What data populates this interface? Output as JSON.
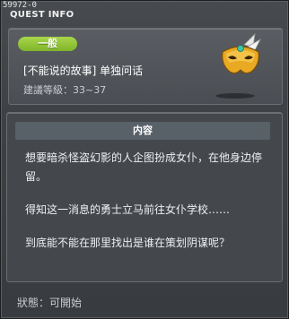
{
  "window": {
    "quest_id": "59972-0",
    "title": "QUEST INFO"
  },
  "quest": {
    "category_badge": "一般",
    "name": "[不能说的故事] 单独问话",
    "level_range": "建議等級：33~37",
    "icon": "gold-masquerade-mask-icon"
  },
  "content": {
    "header": "内容",
    "paragraphs": [
      "想要暗杀怪盗幻影的人企图扮成女仆，在他身边停留。",
      "得知这一消息的勇士立马前往女仆学校……",
      "到底能不能在那里找出是谁在策划阴谋呢？"
    ]
  },
  "status": "狀態：可開始",
  "colors": {
    "badge_green": "#8fc43a",
    "panel_bg": "#44484c",
    "header_bar": "#586068"
  }
}
